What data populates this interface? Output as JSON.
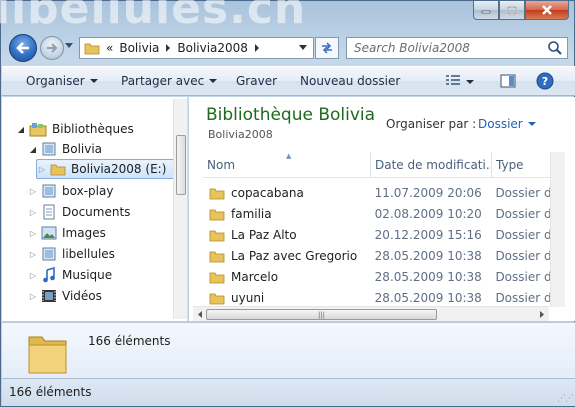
{
  "window": {
    "background_text": "libellules.ch"
  },
  "address": {
    "chevrons": "«",
    "crumbs": [
      "Bolivia",
      "Bolivia2008"
    ],
    "search_placeholder": "Search Bolivia2008"
  },
  "toolbar": {
    "organise": "Organiser",
    "share": "Partager avec",
    "burn": "Graver",
    "new_folder": "Nouveau dossier"
  },
  "nav": {
    "items": [
      {
        "label": "Bibliothèques",
        "icon": "libraries-icon"
      },
      {
        "label": "Bolivia",
        "icon": "library-icon"
      },
      {
        "label": "Bolivia2008 (E:)",
        "icon": "folder-icon"
      },
      {
        "label": "box-play",
        "icon": "library-icon"
      },
      {
        "label": "Documents",
        "icon": "documents-icon"
      },
      {
        "label": "Images",
        "icon": "images-icon"
      },
      {
        "label": "libellules",
        "icon": "library-icon"
      },
      {
        "label": "Musique",
        "icon": "music-icon"
      },
      {
        "label": "Vidéos",
        "icon": "videos-icon"
      }
    ]
  },
  "content": {
    "title": "Bibliothèque Bolivia",
    "subtitle": "Bolivia2008",
    "arrange_label": "Organiser par :",
    "arrange_value": "Dossier",
    "columns": [
      "Nom",
      "Date de modificati...",
      "Type"
    ],
    "rows": [
      {
        "name": "copacabana",
        "date": "11.07.2009 20:06",
        "type": "Dossier de"
      },
      {
        "name": "familia",
        "date": "02.08.2009 10:20",
        "type": "Dossier de"
      },
      {
        "name": "La Paz Alto",
        "date": "20.12.2009 15:16",
        "type": "Dossier de"
      },
      {
        "name": "La Paz avec Gregorio",
        "date": "28.05.2009 10:38",
        "type": "Dossier de"
      },
      {
        "name": "Marcelo",
        "date": "28.05.2009 10:38",
        "type": "Dossier de"
      },
      {
        "name": "uyuni",
        "date": "28.05.2009 10:38",
        "type": "Dossier de"
      }
    ]
  },
  "details": {
    "count": "166 éléments"
  },
  "status": {
    "text": "166 éléments"
  },
  "colors": {
    "title_green": "#1e6a1e",
    "link_blue": "#1d63b8",
    "selection": "#cde4fb"
  }
}
